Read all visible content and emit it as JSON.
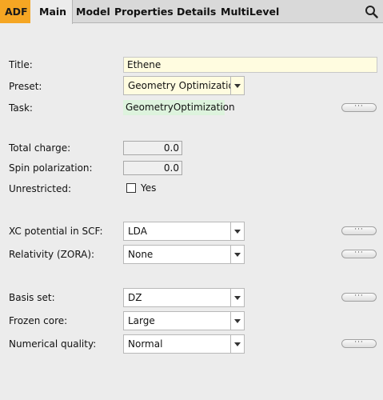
{
  "header": {
    "badge": "ADF",
    "tabs": [
      {
        "label": "Main",
        "active": true
      },
      {
        "label": "Model",
        "active": false
      },
      {
        "label": "Properties",
        "active": false
      },
      {
        "label": "Details",
        "active": false
      },
      {
        "label": "MultiLevel",
        "active": false
      }
    ],
    "search_icon": "search-icon"
  },
  "form": {
    "title": {
      "label": "Title:",
      "value": "Ethene"
    },
    "preset": {
      "label": "Preset:",
      "value": "Geometry Optimization"
    },
    "task": {
      "label": "Task:",
      "value": "GeometryOptimization"
    },
    "total_charge": {
      "label": "Total charge:",
      "value": "0.0"
    },
    "spin_polarization": {
      "label": "Spin polarization:",
      "value": "0.0"
    },
    "unrestricted": {
      "label": "Unrestricted:",
      "checkbox_label": "Yes",
      "checked": false
    },
    "xc_potential": {
      "label": "XC potential in SCF:",
      "value": "LDA"
    },
    "relativity": {
      "label": "Relativity (ZORA):",
      "value": "None"
    },
    "basis_set": {
      "label": "Basis set:",
      "value": "DZ"
    },
    "frozen_core": {
      "label": "Frozen core:",
      "value": "Large"
    },
    "numerical_quality": {
      "label": "Numerical quality:",
      "value": "Normal"
    },
    "more_button_label": "···"
  },
  "colors": {
    "badge": "#f5a623",
    "title_bg": "#fffce0",
    "task_bg": "#ddf3dd"
  }
}
